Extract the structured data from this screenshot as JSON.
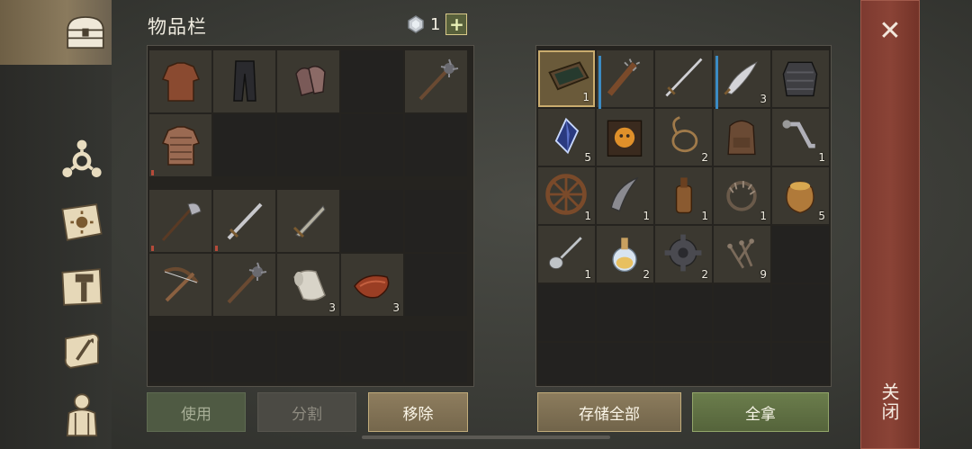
{
  "inventory_title": "物品栏",
  "currency": {
    "value": "1",
    "plus": "+"
  },
  "buttons": {
    "use": "使用",
    "split": "分割",
    "remove": "移除",
    "store_all": "存储全部",
    "take_all": "全拿"
  },
  "close": {
    "x": "✕",
    "label": "关闭"
  },
  "player_slots": [
    {
      "icon": "leather-armor-icon",
      "qty": ""
    },
    {
      "icon": "leather-pants-icon",
      "qty": ""
    },
    {
      "icon": "gloves-icon",
      "qty": ""
    },
    {
      "icon": "",
      "qty": ""
    },
    {
      "icon": "spiked-mace-icon",
      "qty": ""
    },
    {
      "icon": "chainmail-icon",
      "qty": ""
    },
    {
      "icon": "",
      "qty": ""
    },
    {
      "icon": "",
      "qty": ""
    },
    {
      "icon": "",
      "qty": ""
    },
    {
      "icon": "",
      "qty": ""
    },
    {
      "icon": "halberd-icon",
      "qty": ""
    },
    {
      "icon": "sword-icon",
      "qty": ""
    },
    {
      "icon": "short-sword-icon",
      "qty": ""
    },
    {
      "icon": "",
      "qty": ""
    },
    {
      "icon": "",
      "qty": ""
    },
    {
      "icon": "crossbow-icon",
      "qty": ""
    },
    {
      "icon": "spiked-mace-icon",
      "qty": ""
    },
    {
      "icon": "cloth-roll-icon",
      "qty": "3"
    },
    {
      "icon": "leather-strip-icon",
      "qty": "3"
    },
    {
      "icon": "",
      "qty": ""
    }
  ],
  "storage_slots": [
    {
      "icon": "tray-icon",
      "qty": "1"
    },
    {
      "icon": "spiked-club-icon",
      "qty": ""
    },
    {
      "icon": "longsword-icon",
      "qty": ""
    },
    {
      "icon": "scimitar-icon",
      "qty": "3"
    },
    {
      "icon": "plate-armor-icon",
      "qty": ""
    },
    {
      "icon": "crystal-icon",
      "qty": "5"
    },
    {
      "icon": "mask-book-icon",
      "qty": ""
    },
    {
      "icon": "rope-icon",
      "qty": "2"
    },
    {
      "icon": "backpack-icon",
      "qty": ""
    },
    {
      "icon": "crank-icon",
      "qty": "1"
    },
    {
      "icon": "wheel-icon",
      "qty": "1"
    },
    {
      "icon": "bow-part-icon",
      "qty": "1"
    },
    {
      "icon": "bottle-icon",
      "qty": "1"
    },
    {
      "icon": "bear-trap-icon",
      "qty": "1"
    },
    {
      "icon": "grain-sack-icon",
      "qty": "5"
    },
    {
      "icon": "spoon-icon",
      "qty": "1"
    },
    {
      "icon": "potion-icon",
      "qty": "2"
    },
    {
      "icon": "gear-icon",
      "qty": "2"
    },
    {
      "icon": "nails-icon",
      "qty": "9"
    },
    {
      "icon": "",
      "qty": ""
    }
  ]
}
